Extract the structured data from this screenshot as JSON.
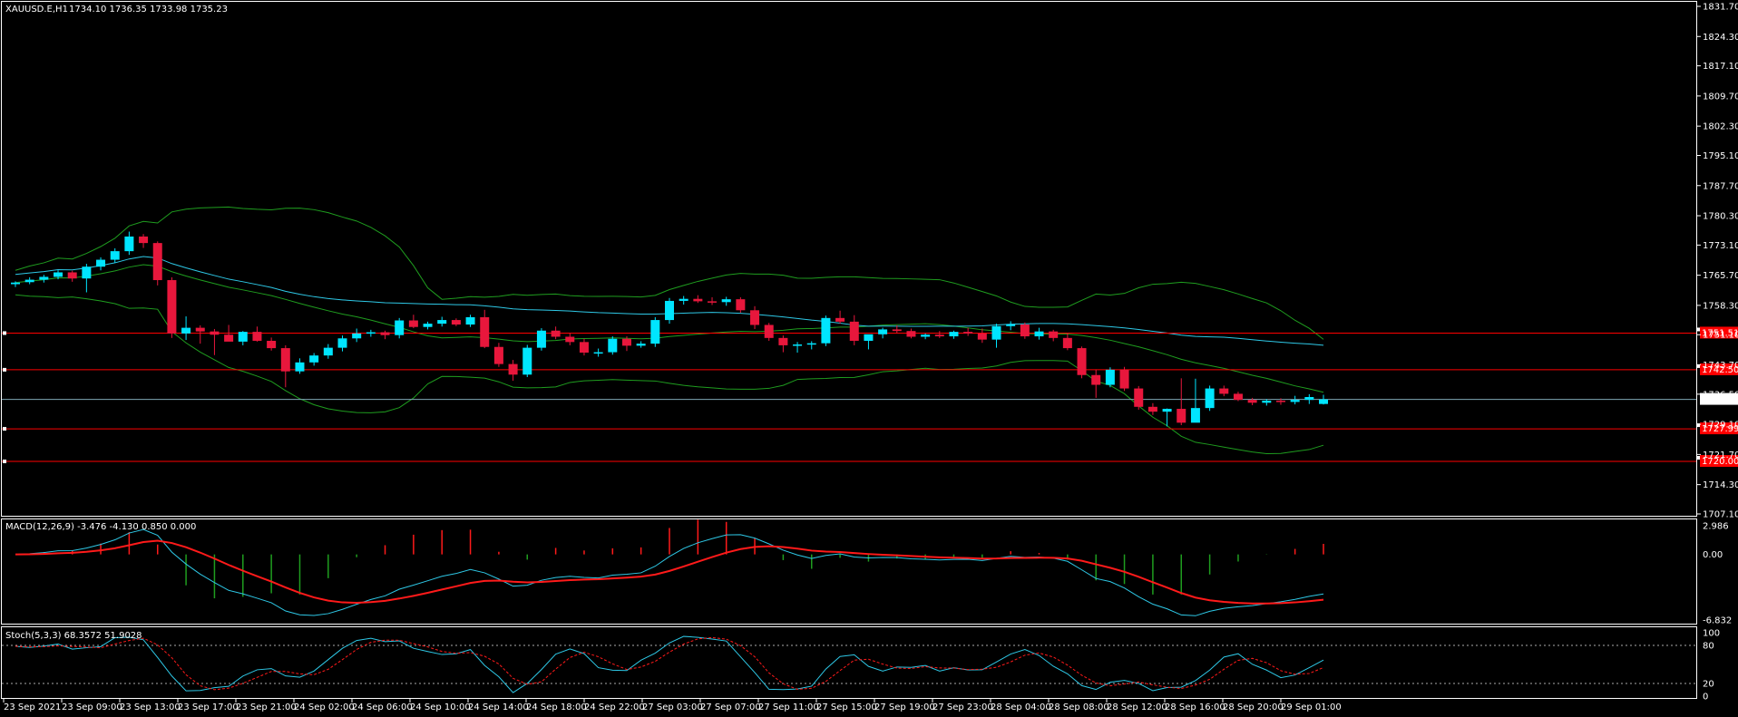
{
  "header": {
    "symbol": "XAUUSD.E,H1",
    "ohlc": "1734.10 1736.35 1733.98 1735.23"
  },
  "colors": {
    "background": "#000000",
    "bull_candle": "#00e5ff",
    "bear_candle": "#e8173c",
    "bollinger": "#1f9d1f",
    "moving_average": "#2ec8e6",
    "hline": "#ff0000",
    "macd_signal": "#ff1a1a",
    "macd_main": "#2ec8e6",
    "stoch_main": "#2ec8e6",
    "stoch_signal": "#ff1a1a"
  },
  "price_axis": {
    "min": 1707.1,
    "max": 1831.7,
    "ticks": [
      "1831.70",
      "1824.30",
      "1817.10",
      "1809.70",
      "1802.30",
      "1795.10",
      "1787.70",
      "1780.30",
      "1773.10",
      "1765.70",
      "1758.30",
      "1751.10",
      "1743.70",
      "1736.50",
      "1729.10",
      "1721.70",
      "1714.30",
      "1707.10"
    ],
    "current_price": "1735.23"
  },
  "hlines": [
    {
      "price": 1751.5,
      "label": "1751.51"
    },
    {
      "price": 1742.5,
      "label": "1742.50"
    },
    {
      "price": 1728.0,
      "label": "1727.99"
    },
    {
      "price": 1720.0,
      "label": "1720.00"
    }
  ],
  "macd": {
    "label": "MACD(12,26,9) -3.476 -4.130 0.850 0.000",
    "ticks": [
      "2.986",
      "0.00",
      "-6.832"
    ],
    "min": -6.832,
    "max": 2.986
  },
  "stoch": {
    "label": "Stoch(5,3,3) 68.3572 51.9028",
    "ticks": [
      "100",
      "80",
      "20",
      "0"
    ]
  },
  "time_axis": {
    "labels": [
      "23 Sep 2021",
      "23 Sep 09:00",
      "23 Sep 13:00",
      "23 Sep 17:00",
      "23 Sep 21:00",
      "24 Sep 02:00",
      "24 Sep 06:00",
      "24 Sep 10:00",
      "24 Sep 14:00",
      "24 Sep 18:00",
      "24 Sep 22:00",
      "27 Sep 03:00",
      "27 Sep 07:00",
      "27 Sep 11:00",
      "27 Sep 15:00",
      "27 Sep 19:00",
      "27 Sep 23:00",
      "28 Sep 04:00",
      "28 Sep 08:00",
      "28 Sep 12:00",
      "28 Sep 16:00",
      "28 Sep 20:00",
      "29 Sep 01:00"
    ]
  },
  "candles": [
    [
      1763.5,
      1764.2,
      1762.8,
      1763.9
    ],
    [
      1764.0,
      1765.2,
      1763.5,
      1764.6
    ],
    [
      1764.6,
      1765.8,
      1763.9,
      1765.3
    ],
    [
      1765.3,
      1766.9,
      1764.7,
      1766.4
    ],
    [
      1766.4,
      1766.8,
      1764.1,
      1764.9
    ],
    [
      1764.9,
      1768.5,
      1761.5,
      1767.8
    ],
    [
      1767.8,
      1770.1,
      1766.9,
      1769.5
    ],
    [
      1769.5,
      1772.3,
      1768.8,
      1771.6
    ],
    [
      1771.6,
      1776.4,
      1770.7,
      1775.2
    ],
    [
      1775.2,
      1775.8,
      1772.4,
      1773.6
    ],
    [
      1773.6,
      1774.0,
      1763.2,
      1764.5
    ],
    [
      1764.5,
      1765.2,
      1750.3,
      1751.4
    ],
    [
      1751.4,
      1755.6,
      1749.8,
      1752.8
    ],
    [
      1752.8,
      1753.4,
      1748.9,
      1751.9
    ],
    [
      1751.9,
      1752.5,
      1746.1,
      1751.1
    ],
    [
      1751.1,
      1753.5,
      1750.2,
      1749.4
    ],
    [
      1749.4,
      1752.0,
      1748.5,
      1751.8
    ],
    [
      1751.8,
      1753.1,
      1749.4,
      1749.6
    ],
    [
      1749.6,
      1750.4,
      1747.2,
      1747.8
    ],
    [
      1747.8,
      1748.5,
      1738.2,
      1742.1
    ],
    [
      1742.1,
      1745.3,
      1741.5,
      1744.3
    ],
    [
      1744.3,
      1746.6,
      1743.5,
      1746.0
    ],
    [
      1746.0,
      1748.8,
      1745.2,
      1747.9
    ],
    [
      1747.9,
      1750.9,
      1747.0,
      1750.2
    ],
    [
      1750.2,
      1752.6,
      1749.3,
      1751.4
    ],
    [
      1751.4,
      1752.3,
      1750.6,
      1751.7
    ],
    [
      1751.7,
      1752.1,
      1750.0,
      1751.0
    ],
    [
      1751.0,
      1755.2,
      1750.2,
      1754.6
    ],
    [
      1754.6,
      1756.0,
      1752.7,
      1753.0
    ],
    [
      1753.0,
      1754.3,
      1752.4,
      1753.8
    ],
    [
      1753.8,
      1755.5,
      1753.1,
      1754.7
    ],
    [
      1754.7,
      1755.1,
      1753.2,
      1753.6
    ],
    [
      1753.6,
      1756.0,
      1753.0,
      1755.4
    ],
    [
      1755.4,
      1757.2,
      1747.8,
      1748.1
    ],
    [
      1748.1,
      1749.1,
      1743.2,
      1743.9
    ],
    [
      1743.9,
      1744.9,
      1739.8,
      1741.3
    ],
    [
      1741.3,
      1748.6,
      1740.7,
      1747.9
    ],
    [
      1747.9,
      1752.7,
      1747.2,
      1752.1
    ],
    [
      1752.1,
      1753.1,
      1750.0,
      1750.6
    ],
    [
      1750.6,
      1751.5,
      1748.5,
      1749.3
    ],
    [
      1749.3,
      1750.1,
      1746.0,
      1746.7
    ],
    [
      1746.7,
      1747.7,
      1745.7,
      1746.8
    ],
    [
      1746.8,
      1750.7,
      1746.2,
      1750.1
    ],
    [
      1750.1,
      1750.7,
      1747.1,
      1748.4
    ],
    [
      1748.4,
      1749.5,
      1747.9,
      1748.9
    ],
    [
      1748.9,
      1755.4,
      1748.1,
      1754.7
    ],
    [
      1754.7,
      1760.1,
      1753.8,
      1759.4
    ],
    [
      1759.4,
      1760.6,
      1758.5,
      1759.9
    ],
    [
      1759.9,
      1760.8,
      1758.9,
      1759.3
    ],
    [
      1759.3,
      1760.3,
      1758.4,
      1759.1
    ],
    [
      1759.1,
      1760.4,
      1758.2,
      1759.8
    ],
    [
      1759.8,
      1760.3,
      1756.5,
      1757.1
    ],
    [
      1757.1,
      1758.1,
      1752.5,
      1753.5
    ],
    [
      1753.5,
      1754.0,
      1749.6,
      1750.3
    ],
    [
      1750.3,
      1750.9,
      1746.8,
      1748.5
    ],
    [
      1748.5,
      1749.3,
      1746.7,
      1748.7
    ],
    [
      1748.7,
      1749.5,
      1747.5,
      1749.0
    ],
    [
      1749.0,
      1755.8,
      1748.3,
      1755.2
    ],
    [
      1755.2,
      1757.0,
      1753.8,
      1754.3
    ],
    [
      1754.3,
      1755.9,
      1748.5,
      1749.6
    ],
    [
      1749.6,
      1750.4,
      1747.5,
      1751.2
    ],
    [
      1751.2,
      1752.8,
      1750.2,
      1752.4
    ],
    [
      1752.4,
      1753.4,
      1751.5,
      1752.0
    ],
    [
      1752.0,
      1752.6,
      1750.2,
      1750.6
    ],
    [
      1750.6,
      1751.4,
      1750.0,
      1751.1
    ],
    [
      1751.1,
      1752.0,
      1750.3,
      1750.7
    ],
    [
      1750.7,
      1752.1,
      1750.1,
      1751.8
    ],
    [
      1751.8,
      1752.8,
      1750.8,
      1751.4
    ],
    [
      1751.4,
      1752.6,
      1749.1,
      1749.9
    ],
    [
      1749.9,
      1753.8,
      1747.9,
      1753.2
    ],
    [
      1753.2,
      1754.4,
      1752.2,
      1753.6
    ],
    [
      1753.6,
      1754.1,
      1750.1,
      1750.7
    ],
    [
      1750.7,
      1752.8,
      1749.9,
      1751.9
    ],
    [
      1751.9,
      1752.3,
      1749.5,
      1750.3
    ],
    [
      1750.3,
      1751.5,
      1747.3,
      1747.8
    ],
    [
      1747.8,
      1748.2,
      1740.4,
      1741.2
    ],
    [
      1741.2,
      1742.5,
      1735.6,
      1738.8
    ],
    [
      1738.8,
      1743.1,
      1738.2,
      1742.5
    ],
    [
      1742.5,
      1743.2,
      1737.3,
      1737.9
    ],
    [
      1737.9,
      1738.5,
      1732.7,
      1733.4
    ],
    [
      1733.4,
      1734.3,
      1731.4,
      1732.2
    ],
    [
      1732.2,
      1733.0,
      1728.6,
      1732.9
    ],
    [
      1732.9,
      1740.4,
      1728.9,
      1729.5
    ],
    [
      1729.5,
      1740.3,
      1732.0,
      1733.1
    ],
    [
      1733.1,
      1738.6,
      1732.4,
      1737.9
    ],
    [
      1737.9,
      1738.6,
      1736.0,
      1736.6
    ],
    [
      1736.6,
      1737.1,
      1734.8,
      1735.1
    ],
    [
      1735.1,
      1735.6,
      1733.8,
      1734.4
    ],
    [
      1734.4,
      1735.3,
      1733.7,
      1734.9
    ],
    [
      1734.9,
      1735.5,
      1733.9,
      1734.6
    ],
    [
      1734.6,
      1736.1,
      1734.0,
      1735.1
    ],
    [
      1735.1,
      1736.5,
      1734.1,
      1735.8
    ],
    [
      1734.1,
      1736.35,
      1733.98,
      1735.23
    ]
  ]
}
